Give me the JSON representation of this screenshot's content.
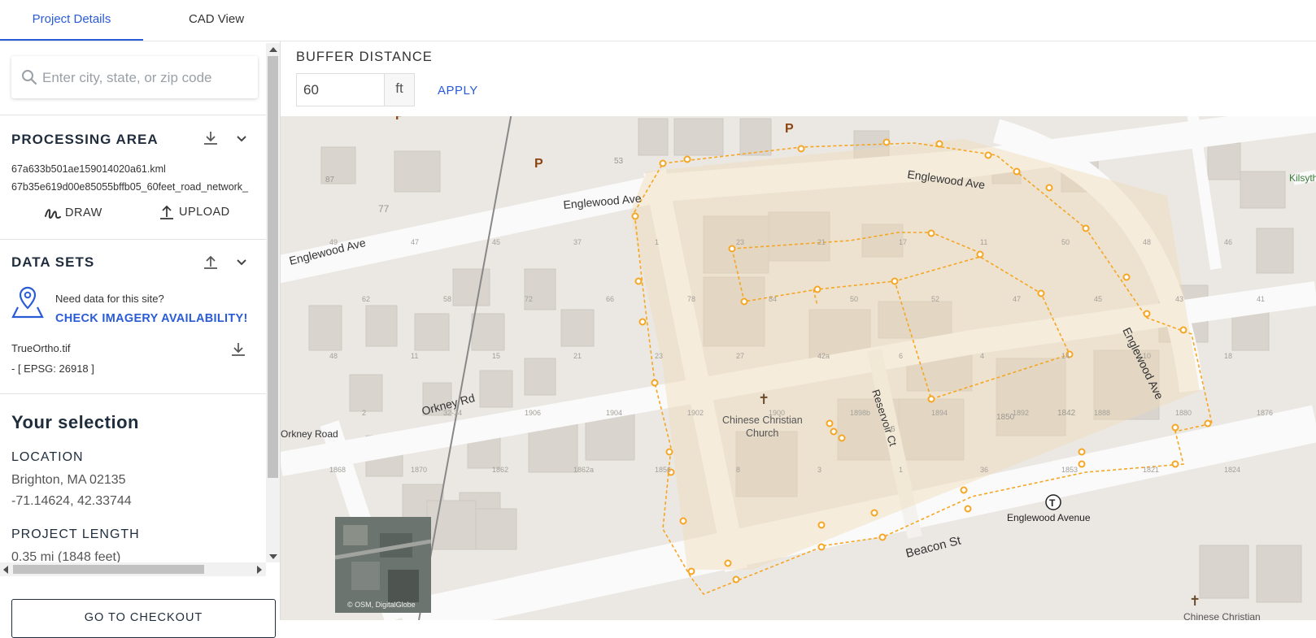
{
  "tabs": [
    {
      "label": "Project Details",
      "active": true
    },
    {
      "label": "CAD View",
      "active": false
    }
  ],
  "search": {
    "placeholder": "Enter city, state, or zip code",
    "icon": "search-icon"
  },
  "processing_area": {
    "title": "PROCESSING AREA",
    "files": [
      "67a633b501ae159014020a61.kml",
      "67b35e619d00e85055bffb05_60feet_road_network_"
    ],
    "draw_label": "DRAW",
    "upload_label": "UPLOAD"
  },
  "data_sets": {
    "title": "DATA SETS",
    "prompt": "Need data for this site?",
    "link": "CHECK IMAGERY AVAILABILITY!",
    "file_name": "TrueOrtho.tif",
    "epsg": "- [ EPSG: 26918 ]"
  },
  "selection": {
    "heading": "Your selection",
    "location_label": "LOCATION",
    "location_value": "Brighton, MA 02135",
    "coords": "-71.14624, 42.33744",
    "length_label": "PROJECT LENGTH",
    "length_value": "0.35 mi (1848 feet)"
  },
  "checkout_label": "GO TO CHECKOUT",
  "buffer": {
    "title": "BUFFER DISTANCE",
    "value": "60",
    "unit": "ft",
    "apply_label": "APPLY"
  },
  "map": {
    "street_labels": [
      "Englewood Ave",
      "Englewood Ave",
      "Englewood Ave",
      "Englewood Ave",
      "Orkney Rd",
      "Orkney Road",
      "Reservoir Ct",
      "Beacon St"
    ],
    "poi_labels": [
      "Chinese Christian",
      "Church",
      "Englewood Avenue",
      "Kilsyth",
      "Chinese Christian"
    ],
    "house_numbers": [
      "77",
      "87",
      "53",
      "49",
      "47",
      "45",
      "37",
      "1",
      "23",
      "21",
      "17",
      "11",
      "50",
      "48",
      "46",
      "62",
      "58",
      "72",
      "66",
      "78",
      "84",
      "50",
      "52",
      "47",
      "45",
      "43",
      "41",
      "48",
      "11",
      "15",
      "21",
      "23",
      "27",
      "42a",
      "6",
      "4",
      "14",
      "10",
      "18",
      "2",
      "32-34",
      "1906",
      "1904",
      "1902",
      "1900",
      "1898b",
      "1894",
      "1892",
      "1888",
      "1880",
      "1876",
      "1868",
      "1870",
      "1862",
      "1862a",
      "1856",
      "1850",
      "1842",
      "8",
      "6",
      "3",
      "1",
      "36",
      "1853",
      "1821",
      "1824",
      "1829"
    ],
    "attribution": "© OSM, DigitalGlobe",
    "accent_color": "#f5a623"
  }
}
